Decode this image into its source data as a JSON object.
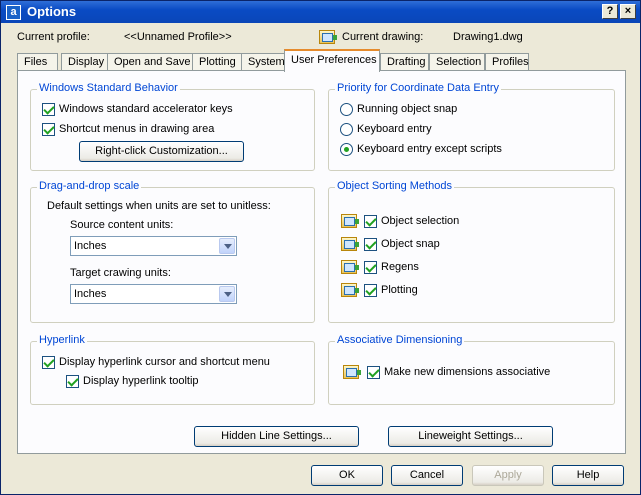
{
  "window": {
    "title": "Options",
    "app_icon": "a",
    "help_glyph": "?",
    "close_glyph": "×"
  },
  "profile": {
    "current_profile_label": "Current profile:",
    "current_profile_value": "<<Unnamed Profile>>",
    "current_drawing_label": "Current drawing:",
    "current_drawing_value": "Drawing1.dwg"
  },
  "tabs": [
    {
      "label": "Files"
    },
    {
      "label": "Display"
    },
    {
      "label": "Open and Save"
    },
    {
      "label": "Plotting"
    },
    {
      "label": "System"
    },
    {
      "label": "User Preferences",
      "active": true
    },
    {
      "label": "Drafting"
    },
    {
      "label": "Selection"
    },
    {
      "label": "Profiles"
    }
  ],
  "windows_standard": {
    "title": "Windows Standard Behavior",
    "accelerator_keys": "Windows standard accelerator keys",
    "shortcut_menus": "Shortcut menus in drawing area",
    "right_click_button": "Right-click Customization..."
  },
  "priority": {
    "title": "Priority for Coordinate Data Entry",
    "options": [
      "Running object snap",
      "Keyboard entry",
      "Keyboard entry except scripts"
    ],
    "selected_index": 2
  },
  "drag_drop": {
    "title": "Drag-and-drop scale",
    "description": "Default settings when units are set to unitless:",
    "source_label": "Source content units:",
    "source_value": "Inches",
    "target_label": "Target crawing units:",
    "target_value": "Inches"
  },
  "object_sorting": {
    "title": "Object Sorting Methods",
    "items": [
      "Object selection",
      "Object snap",
      "Regens",
      "Plotting"
    ]
  },
  "hyperlink": {
    "title": "Hyperlink",
    "cursor_menu": "Display hyperlink cursor and shortcut menu",
    "tooltip": "Display hyperlink tooltip"
  },
  "assoc_dim": {
    "title": "Associative Dimensioning",
    "make_new": "Make new dimensions associative"
  },
  "panel_buttons": {
    "hidden_line": "Hidden Line Settings...",
    "lineweight": "Lineweight Settings..."
  },
  "footer": {
    "ok": "OK",
    "cancel": "Cancel",
    "apply": "Apply",
    "help": "Help"
  }
}
